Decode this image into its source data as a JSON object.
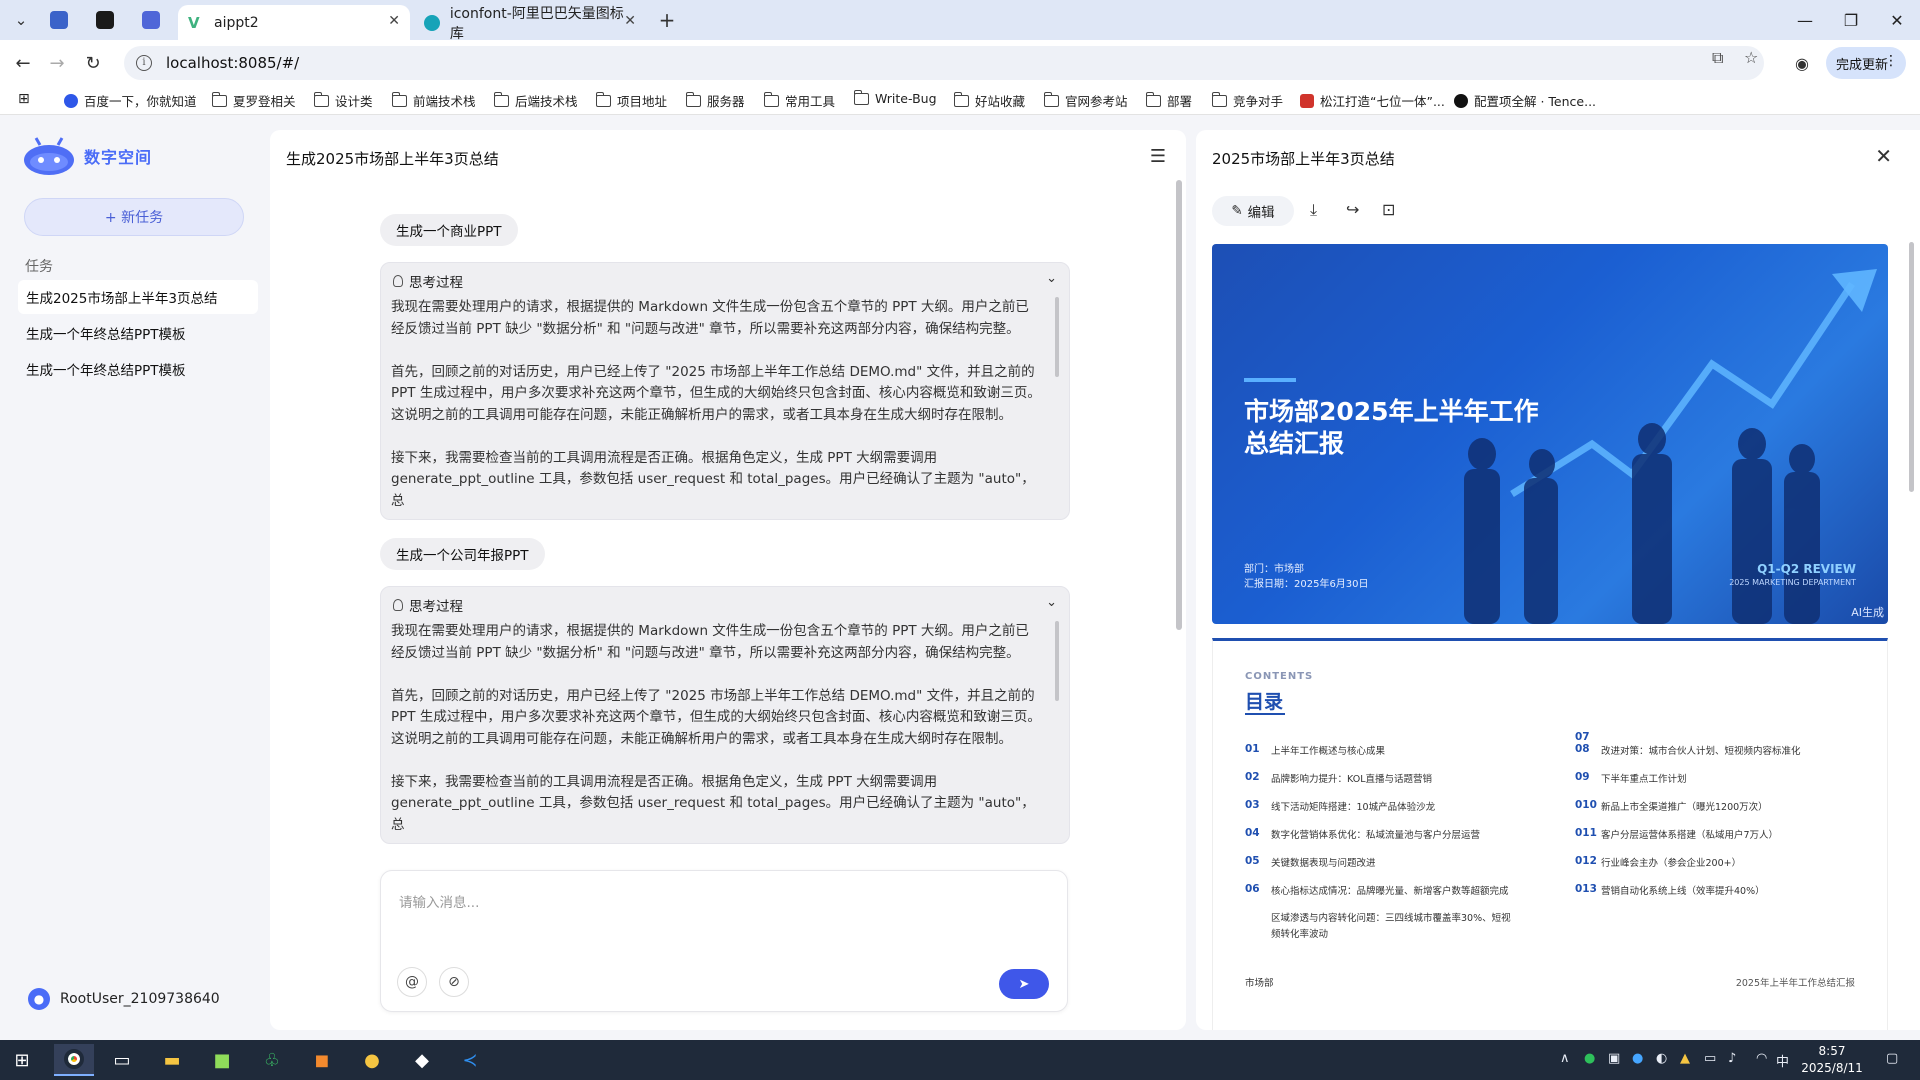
{
  "browser": {
    "tabs": [
      {
        "title": "aippt2",
        "active": true
      },
      {
        "title": "iconfont-阿里巴巴矢量图标库",
        "active": false
      }
    ],
    "new_tab": "+",
    "url": "localhost:8085/#/",
    "update_button": "完成更新"
  },
  "bookmarks": [
    "百度一下，你就知道",
    "夏罗登相关",
    "设计类",
    "前端技术栈",
    "后端技术栈",
    "项目地址",
    "服务器",
    "常用工具",
    "Write-Bug",
    "好站收藏",
    "官网参考站",
    "部署",
    "竞争对手",
    "松江打造“七位一体”...",
    "配置项全解 · Tence..."
  ],
  "sidebar": {
    "brand": "数字空间",
    "new_task": "+ 新任务",
    "tasks_header": "任务",
    "tasks": [
      "生成2025市场部上半年3页总结",
      "生成一个年终总结PPT模板",
      "生成一个年终总结PPT模板"
    ],
    "user": "RootUser_2109738640"
  },
  "chat": {
    "title": "生成2025市场部上半年3页总结",
    "messages": [
      {
        "prompt": "生成一个商业PPT"
      },
      {
        "prompt": "生成一个公司年报PPT"
      }
    ],
    "thinking": {
      "header": "思考过程",
      "paragraphs": [
        "我现在需要处理用户的请求，根据提供的 Markdown 文件生成一份包含五个章节的 PPT 大纲。用户之前已经反馈过当前 PPT 缺少 \"数据分析\" 和 \"问题与改进\" 章节，所以需要补充这两部分内容，确保结构完整。",
        "首先，回顾之前的对话历史，用户已经上传了 \"2025 市场部上半年工作总结 DEMO.md\" 文件，并且之前的 PPT 生成过程中，用户多次要求补充这两个章节，但生成的大纲始终只包含封面、核心内容概览和致谢三页。这说明之前的工具调用可能存在问题，未能正确解析用户的需求，或者工具本身在生成大纲时存在限制。",
        "接下来，我需要检查当前的工具调用流程是否正确。根据角色定义，生成 PPT 大纲需要调用 generate_ppt_outline 工具，参数包括 user_request 和 total_pages。用户已经确认了主题为 \"auto\"，总"
      ]
    },
    "input_placeholder": "请输入消息..."
  },
  "preview": {
    "title": "2025市场部上半年3页总结",
    "edit_label": "编辑",
    "slide1": {
      "title": "市场部2025年上半年工作总结汇报",
      "dept": "部门：市场部",
      "date": "汇报日期：2025年6月30日",
      "tag": "Q1-Q2 REVIEW",
      "subtag": "2025 MARKETING DEPARTMENT",
      "ai": "AI生成"
    },
    "slide2": {
      "contents_en": "CONTENTS",
      "contents_cn": "目录",
      "left": [
        {
          "n": "01",
          "t": "上半年工作概述与核心成果"
        },
        {
          "n": "02",
          "t": "品牌影响力提升：KOL直播与话题营销"
        },
        {
          "n": "03",
          "t": "线下活动矩阵搭建：10城产品体验沙龙"
        },
        {
          "n": "04",
          "t": "数字化营销体系优化：私域流量池与客户分层运营"
        },
        {
          "n": "05",
          "t": "关键数据表现与问题改进"
        },
        {
          "n": "06",
          "t": "核心指标达成情况：品牌曝光量、新增客户数等超额完成"
        }
      ],
      "left_extra": "区域渗透与内容转化问题：三四线城市覆盖率30%、短视频转化率波动",
      "right_top": "07",
      "right": [
        {
          "n": "08",
          "t": "改进对策：城市合伙人计划、短视频内容标准化"
        },
        {
          "n": "09",
          "t": "下半年重点工作计划"
        },
        {
          "n": "010",
          "t": "新品上市全渠道推广（曝光1200万次）"
        },
        {
          "n": "011",
          "t": "客户分层运营体系搭建（私域用户7万人）"
        },
        {
          "n": "012",
          "t": "行业峰会主办（参会企业200+）"
        },
        {
          "n": "013",
          "t": "营销自动化系统上线（效率提升40%）"
        }
      ],
      "footer_left": "市场部",
      "footer_right": "2025年上半年工作总结汇报"
    }
  },
  "taskbar": {
    "time": "8:57",
    "date": "2025/8/11",
    "ime": "中"
  }
}
